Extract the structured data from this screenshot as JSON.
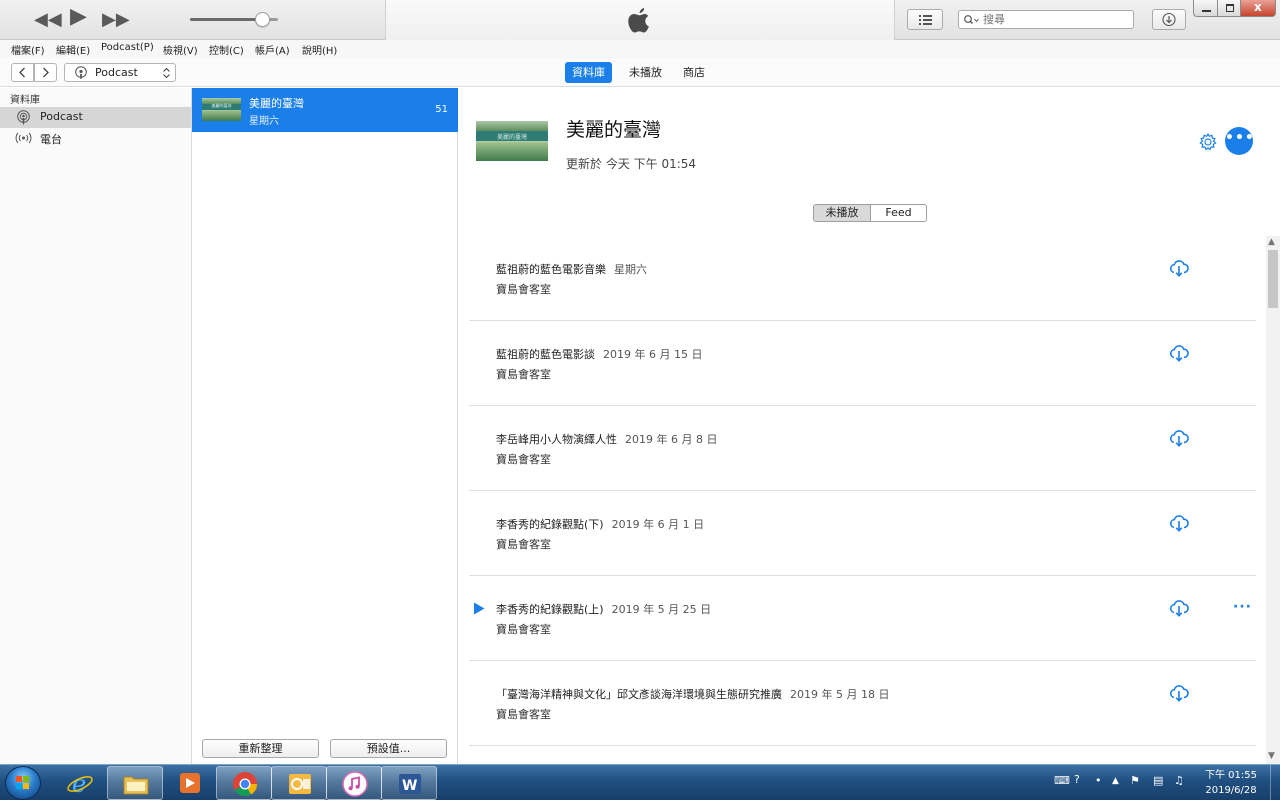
{
  "search": {
    "placeholder": "搜尋"
  },
  "menu": [
    "檔案(F)",
    "編輯(E)",
    "Podcast(P)",
    "檢視(V)",
    "控制(C)",
    "帳戶(A)",
    "說明(H)"
  ],
  "player": {
    "volume_fraction": 0.82
  },
  "nav": {
    "media_select": "Podcast",
    "tabs": [
      "資料庫",
      "未播放",
      "商店"
    ],
    "active_tab": "資料庫"
  },
  "sidebar": {
    "heading": "資料庫",
    "items": [
      {
        "label": "Podcast",
        "icon": "podcast-icon",
        "selected": true
      },
      {
        "label": "電台",
        "icon": "radio-icon",
        "selected": false
      }
    ]
  },
  "podcast_list": {
    "items": [
      {
        "title": "美麗的臺灣",
        "subtitle": "星期六",
        "count": "51"
      }
    ],
    "artwork_text": "美麗的臺灣",
    "buttons": {
      "refresh": "重新整理",
      "defaults": "預設值..."
    }
  },
  "detail": {
    "title": "美麗的臺灣",
    "updated": "更新於 今天 下午 01:54",
    "segment": [
      "未播放",
      "Feed"
    ],
    "episodes": [
      {
        "title": "藍祖蔚的藍色電影音樂",
        "date": "星期六",
        "author": "寶島會客室"
      },
      {
        "title": "藍祖蔚的藍色電影談",
        "date": "2019 年 6 月 15 日",
        "author": "寶島會客室"
      },
      {
        "title": "李岳峰用小人物演繹人性",
        "date": "2019 年 6 月 8 日",
        "author": "寶島會客室"
      },
      {
        "title": "李香秀的紀錄觀點(下)",
        "date": "2019 年 6 月 1 日",
        "author": "寶島會客室"
      },
      {
        "title": "李香秀的紀錄觀點(上)",
        "date": "2019 年 5 月 25 日",
        "author": "寶島會客室",
        "now_playing": true,
        "more": "···"
      },
      {
        "title": "「臺灣海洋精神與文化」邱文彥談海洋環境與生態研究推廣",
        "date": "2019 年 5 月 18 日",
        "author": "寶島會客室"
      }
    ]
  },
  "taskbar": {
    "apps": [
      "internet-explorer",
      "file-explorer",
      "media-player",
      "chrome",
      "outlook",
      "itunes",
      "word"
    ],
    "clock_time": "下午 01:55",
    "clock_date": "2019/6/28"
  },
  "colors": {
    "accent": "#1a7fe8",
    "taskbar": "#1f4f80"
  }
}
